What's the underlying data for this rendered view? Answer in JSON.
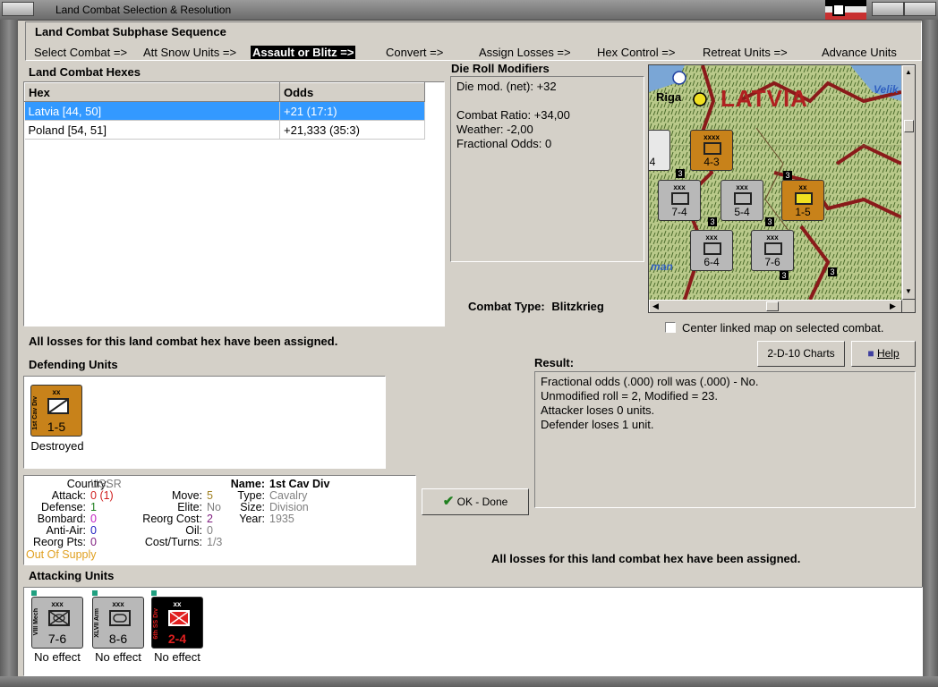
{
  "window": {
    "title": "Land Combat Selection & Resolution"
  },
  "subphase": {
    "header": "Land Combat Subphase Sequence",
    "steps": [
      "Select Combat =>",
      "Att Snow Units =>",
      "Assault or Blitz =>",
      "Convert =>",
      "Assign Losses =>",
      "Hex Control =>",
      "Retreat Units =>",
      "Advance Units"
    ],
    "active_index": 2
  },
  "hexes": {
    "title": "Land Combat Hexes",
    "columns": [
      "Hex",
      "Odds"
    ],
    "rows": [
      {
        "hex": "Latvia [44, 50]",
        "odds": "+21 (17:1)"
      },
      {
        "hex": "Poland [54, 51]",
        "odds": "+21,333 (35:3)"
      }
    ]
  },
  "modifiers": {
    "title": "Die Roll Modifiers",
    "lines": [
      "Die mod. (net): +32",
      "",
      "Combat Ratio: +34,00",
      "Weather: -2,00",
      "Fractional Odds: 0"
    ]
  },
  "map": {
    "region_label": "LATVIA",
    "city_label": "Riga",
    "edge_label_1": "Velik",
    "edge_label_2": "man",
    "units": [
      {
        "label": "4-3",
        "name": "Ninth Inf",
        "size": "xxxx",
        "color": "#c8821a"
      },
      {
        "label": "7-4",
        "name": "X Inf",
        "size": "xxx",
        "color": "#b8b8b8"
      },
      {
        "label": "5-4",
        "name": "Alpine",
        "size": "xxx",
        "color": "#b8b8b8"
      },
      {
        "label": "1-5",
        "name": "1st Cav Div",
        "size": "xx",
        "color": "#c8821a"
      },
      {
        "label": "6-4",
        "name": "XXVIII Inf",
        "size": "xxx",
        "color": "#b8b8b8"
      },
      {
        "label": "7-6",
        "name": "VIII Mech",
        "size": "xxx",
        "color": "#b8b8b8"
      },
      {
        "label": "4",
        "name": "",
        "size": "",
        "color": "#b8b8b8"
      }
    ],
    "stack_counts": [
      "3",
      "3",
      "3",
      "3",
      "3",
      "3"
    ]
  },
  "combat_type": {
    "label": "Combat Type:",
    "value": "Blitzkrieg"
  },
  "center_map": {
    "label": "Center linked map on selected combat.",
    "checked": false
  },
  "status_assigned": "All losses for this land combat hex have been assigned.",
  "defending": {
    "title": "Defending Units",
    "units": [
      {
        "name": "1st Cav Div",
        "size": "xx",
        "strength": "1-5",
        "status": "Destroyed",
        "color": "#c8821a"
      }
    ]
  },
  "buttons": {
    "charts": "2-D-10 Charts",
    "help": "Help",
    "ok": "OK - Done"
  },
  "result": {
    "title": "Result:",
    "lines": [
      "Fractional odds (.000) roll was (.000)  - No.",
      "Unmodified roll = 2, Modified = 23.",
      "Attacker loses 0 units.",
      "Defender loses 1 unit."
    ]
  },
  "unit_info": {
    "country_label": "Country:",
    "country": "USSR",
    "attack_label": "Attack:",
    "attack": "0",
    "attack_extra": "(1)",
    "defense_label": "Defense:",
    "defense": "1",
    "bombard_label": "Bombard:",
    "bombard": "0",
    "antiair_label": "Anti-Air:",
    "antiair": "0",
    "reorgpts_label": "Reorg Pts:",
    "reorgpts": "0",
    "supply": "Out Of Supply",
    "move_label": "Move:",
    "move": "5",
    "elite_label": "Elite:",
    "elite": "No",
    "reorgcost_label": "Reorg Cost:",
    "reorgcost": "2",
    "oil_label": "Oil:",
    "oil": "0",
    "costturns_label": "Cost/Turns:",
    "costturns": "1/3",
    "name_label": "Name:",
    "name": "1st Cav Div",
    "type_label": "Type:",
    "type": "Cavalry",
    "size_label": "Size:",
    "size": "Division",
    "year_label": "Year:",
    "year": "1935"
  },
  "attacking": {
    "title": "Attacking Units",
    "units": [
      {
        "name": "VIII Mech",
        "size": "xxx",
        "strength": "7-6",
        "status": "No effect",
        "color": "#b8b8b8"
      },
      {
        "name": "XLVII Arm",
        "size": "xxx",
        "strength": "8-6",
        "status": "No effect",
        "color": "#b8b8b8"
      },
      {
        "name": "6th SS Div",
        "size": "xx",
        "strength": "2-4",
        "status": "No effect",
        "color": "#000000"
      }
    ]
  }
}
